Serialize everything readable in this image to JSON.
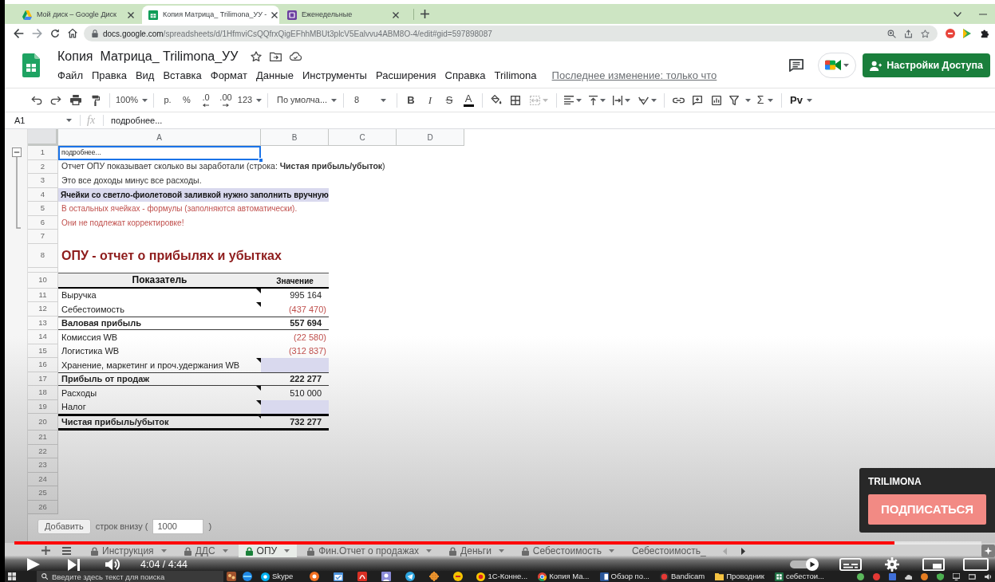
{
  "browser": {
    "tabs": [
      {
        "title": "Мой диск – Google Диск",
        "selected": false
      },
      {
        "title": "Копия Матрица_ Trilimona_УУ -",
        "selected": true
      },
      {
        "title": "Еженедельные",
        "selected": false
      }
    ],
    "url": {
      "host": "docs.google.com",
      "path": "/spreadsheets/d/1HfmviCsQQfrxQigEFhhMBUt3plcV5Ealvvu4ABM8O-4/edit#gid=597898087"
    }
  },
  "document": {
    "title": "Копия  Матрица_ Trilimona_УУ",
    "menu": [
      "Файл",
      "Правка",
      "Вид",
      "Вставка",
      "Формат",
      "Данные",
      "Инструменты",
      "Расширения",
      "Справка",
      "Trilimona"
    ],
    "last_edit": "Последнее изменение: только что",
    "share_button": "Настройки Доступа"
  },
  "toolbar": {
    "zoom": "100%",
    "currency": "р.",
    "percent": "%",
    "fewer_decimals": ".0",
    "more_decimals": ".00",
    "number_format": "123",
    "font": "По умолча...",
    "font_size": "8",
    "bold": "B",
    "italic": "I",
    "strikethrough": "S",
    "text_color": "A",
    "functions": "Σ",
    "input_tools": "Pv"
  },
  "formula_bar": {
    "cell": "A1",
    "fx": "fx",
    "content": "подробнее..."
  },
  "sheet": {
    "row_group": {
      "expanded": true
    },
    "columns": [
      "A",
      "B",
      "C",
      "D"
    ],
    "rows": [
      {
        "number": "1",
        "kind": "small",
        "text": "подробнее...",
        "selected": true
      },
      {
        "number": "2",
        "kind": "plain",
        "text": "Отчет ОПУ показывает сколько вы заработали (строка: **Чистая прибыль/убыток**)",
        "selected": false
      },
      {
        "number": "3",
        "kind": "plain",
        "text": "Это все доходы минус все расходы.",
        "selected": false
      },
      {
        "number": "4",
        "kind": "filled",
        "text": "Ячейки со светло-фиолетовой заливкой нужно заполнить вручную",
        "selected": false
      },
      {
        "number": "5",
        "kind": "warning",
        "text": "В остальных ячейках - формулы (заполняются автоматически).",
        "selected": false
      },
      {
        "number": "6",
        "kind": "warning",
        "text": "Они не подлежат корректировке!",
        "selected": false
      },
      {
        "number": "7",
        "kind": "blank",
        "selected": false
      },
      {
        "number": "8",
        "kind": "title",
        "text": "ОПУ - отчет о прибылях и убытках",
        "selected": false
      },
      {
        "kind": "spacer",
        "selected": false
      },
      {
        "number": "10",
        "kind": "header",
        "label": "Показатель",
        "value": "Значение",
        "selected": false
      },
      {
        "number": "11",
        "kind": "item",
        "label": "Выручка",
        "value": "995 164",
        "negative": false,
        "input": false,
        "note": true,
        "selected": false
      },
      {
        "number": "12",
        "kind": "item",
        "label": "Себестоимость",
        "value": "(437 470)",
        "negative": true,
        "input": false,
        "note": true,
        "selected": false
      },
      {
        "number": "13",
        "kind": "subtotal",
        "label": "Валовая прибыль",
        "value": "557 694",
        "negative": false,
        "input": false,
        "note": false,
        "selected": false
      },
      {
        "number": "14",
        "kind": "item",
        "label": "Комиссия WB",
        "value": "(22 580)",
        "negative": true,
        "input": false,
        "note": false,
        "selected": false
      },
      {
        "number": "15",
        "kind": "item",
        "label": "Логистика WB",
        "value": "(312 837)",
        "negative": true,
        "input": false,
        "note": false,
        "selected": false
      },
      {
        "number": "16",
        "kind": "item",
        "label": "Хранение, маркетинг и проч.удержания WB",
        "input": true,
        "note": true,
        "selected": false
      },
      {
        "number": "17",
        "kind": "subtotal",
        "label": "Прибыль от продаж",
        "value": "222 277",
        "negative": false,
        "input": false,
        "note": false,
        "selected": false
      },
      {
        "number": "18",
        "kind": "item",
        "label": "Расходы",
        "value": "510 000",
        "negative": false,
        "input": false,
        "note": true,
        "selected": false
      },
      {
        "number": "19",
        "kind": "item",
        "label": "Налог",
        "input": true,
        "note": true,
        "selected": false
      },
      {
        "number": "20",
        "kind": "total",
        "label": "Чистая прибыль/убыток",
        "value": "732 277",
        "negative": false,
        "input": false,
        "note": true,
        "selected": false
      },
      {
        "number": "21",
        "kind": "blank",
        "selected": false
      },
      {
        "number": "22",
        "kind": "blank",
        "selected": false
      },
      {
        "number": "23",
        "kind": "blank",
        "selected": false
      },
      {
        "number": "24",
        "kind": "blank",
        "selected": false
      },
      {
        "number": "25",
        "kind": "blank",
        "selected": false
      },
      {
        "number": "26",
        "kind": "blank",
        "selected": false
      }
    ]
  },
  "add_rows": {
    "button": "Добавить",
    "label": "строк внизу (",
    "count": "1000",
    "closing": ")"
  },
  "sheet_tabs": [
    {
      "label": "Инструкция",
      "locked": true,
      "menu": true,
      "selected": false
    },
    {
      "label": "ДДС",
      "locked": true,
      "menu": true,
      "selected": false
    },
    {
      "label": "ОПУ",
      "locked": true,
      "menu": true,
      "selected": true
    },
    {
      "label": "Фин.Отчет о продажах",
      "locked": true,
      "menu": true,
      "selected": false
    },
    {
      "label": "Деньги",
      "locked": true,
      "menu": true,
      "selected": false
    },
    {
      "label": "Себестоимость",
      "locked": true,
      "menu": true,
      "selected": false
    },
    {
      "label": "Себестоимость_",
      "locked": false,
      "menu": false,
      "selected": false
    }
  ],
  "video": {
    "progress": {
      "level": 0.91
    },
    "time": "4:04 / 4:44",
    "channel": "TRILIMONA",
    "subscribe_button": "ПОДПИСАТЬСЯ"
  },
  "taskbar": {
    "search": {
      "placeholder": "Введите здесь текст для поиска"
    },
    "apps": [
      {
        "label": "Skype"
      },
      {
        "label": "1С-Конне..."
      },
      {
        "label": "Копия Ма..."
      },
      {
        "label": "Обзор по..."
      },
      {
        "label": "Bandicam"
      },
      {
        "label": "Проводник"
      },
      {
        "label": "себестои..."
      }
    ]
  }
}
